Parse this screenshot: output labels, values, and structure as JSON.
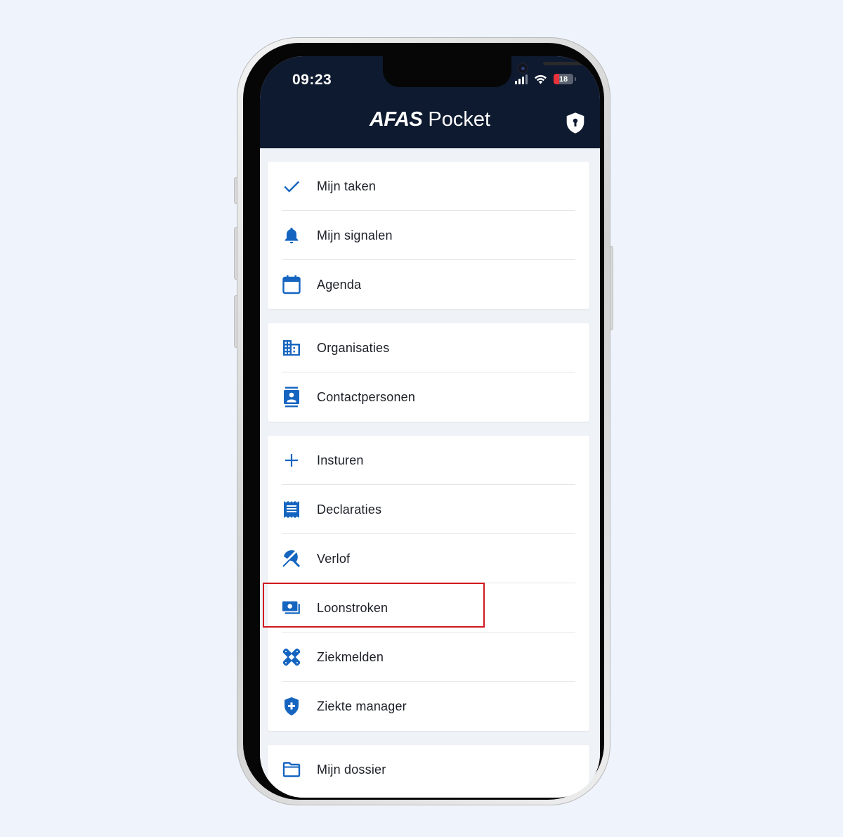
{
  "status_bar": {
    "time": "09:23",
    "battery": "18"
  },
  "header": {
    "brand": "AFAS",
    "product": "Pocket"
  },
  "menu_groups": [
    [
      {
        "label": "Mijn taken",
        "icon": "check-icon"
      },
      {
        "label": "Mijn signalen",
        "icon": "bell-icon"
      },
      {
        "label": "Agenda",
        "icon": "calendar-icon"
      }
    ],
    [
      {
        "label": "Organisaties",
        "icon": "building-icon"
      },
      {
        "label": "Contactpersonen",
        "icon": "contact-card-icon"
      }
    ],
    [
      {
        "label": "Insturen",
        "icon": "plus-icon"
      },
      {
        "label": "Declaraties",
        "icon": "receipt-icon"
      },
      {
        "label": "Verlof",
        "icon": "beach-umbrella-icon"
      },
      {
        "label": "Loonstroken",
        "icon": "payslip-money-icon"
      },
      {
        "label": "Ziekmelden",
        "icon": "bandage-icon"
      },
      {
        "label": "Ziekte manager",
        "icon": "medical-shield-icon"
      }
    ],
    [
      {
        "label": "Mijn dossier",
        "icon": "folder-icon"
      }
    ]
  ],
  "colors": {
    "header_bg": "#0e1a2f",
    "icon_blue": "#1565c0",
    "highlight_red": "#d0191e",
    "page_bg": "#eff4fc"
  }
}
